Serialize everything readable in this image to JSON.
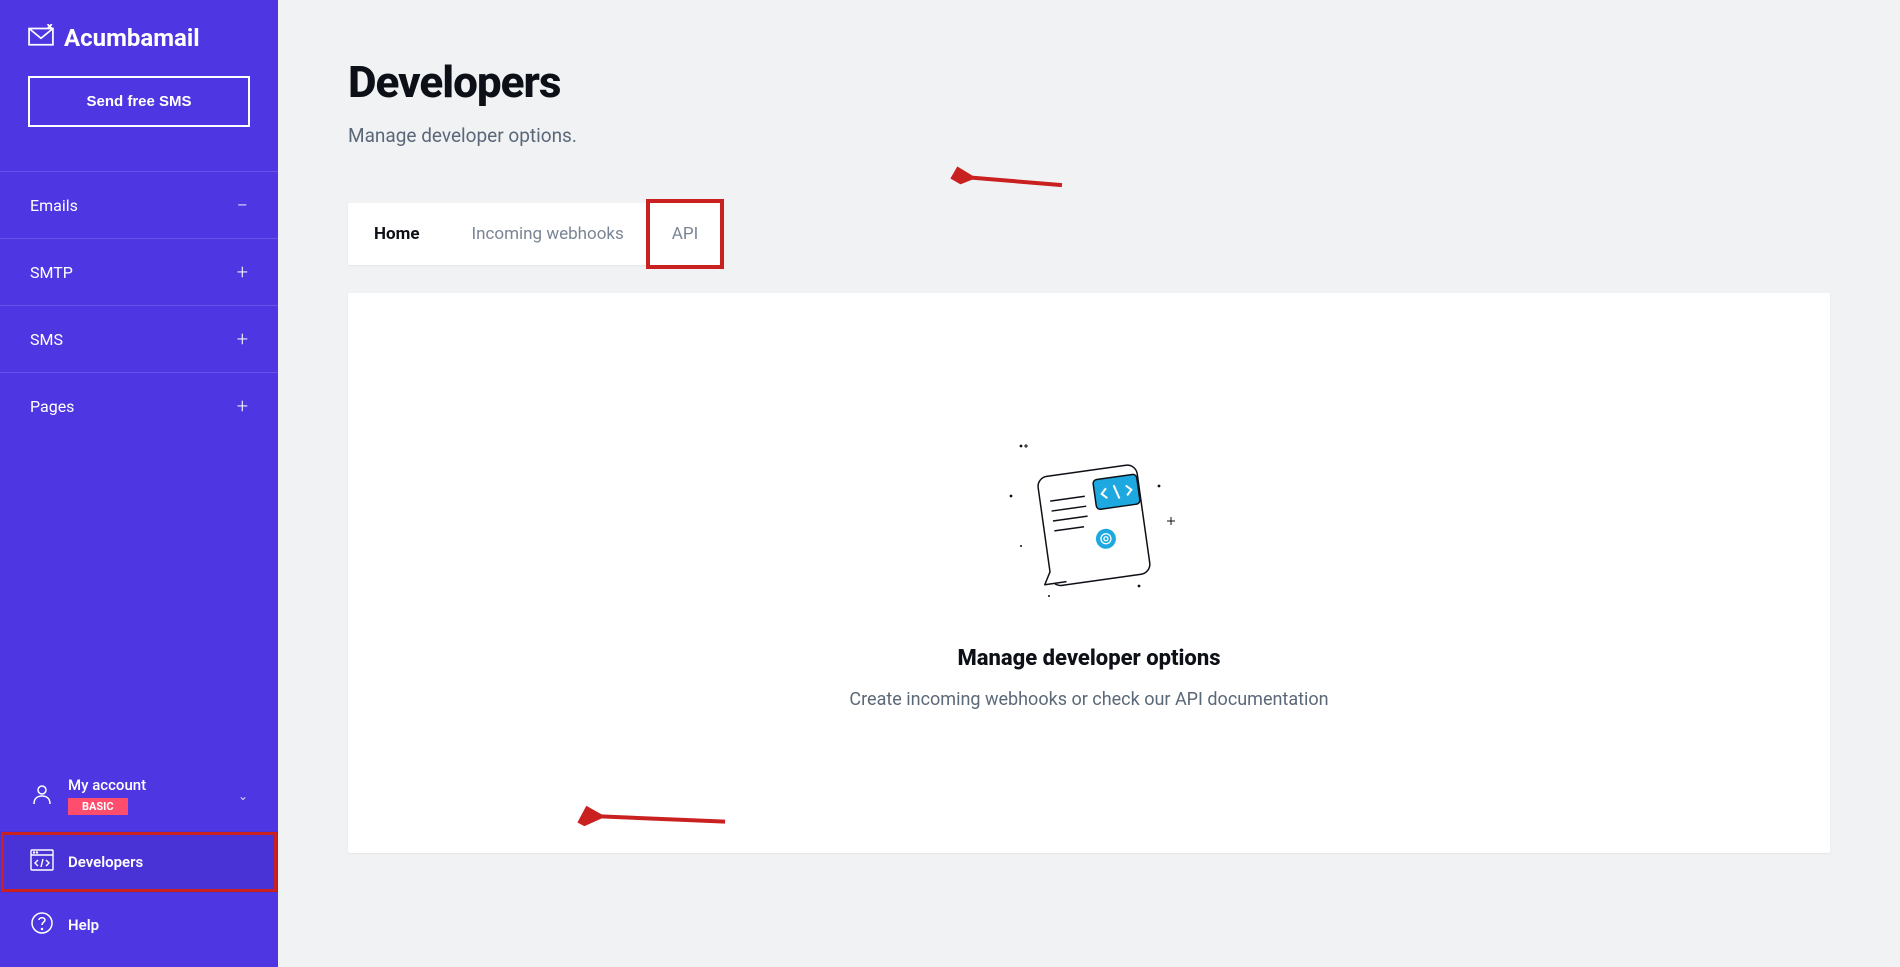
{
  "brand": {
    "name": "Acumbamail"
  },
  "sidebar": {
    "cta_label": "Send free SMS",
    "nav": [
      {
        "label": "Emails",
        "expanded": true
      },
      {
        "label": "SMTP",
        "expanded": false
      },
      {
        "label": "SMS",
        "expanded": false
      },
      {
        "label": "Pages",
        "expanded": false
      }
    ],
    "account": {
      "label": "My account",
      "badge": "BASIC"
    },
    "bottom": [
      {
        "label": "Developers",
        "highlighted": true
      },
      {
        "label": "Help",
        "highlighted": false
      }
    ]
  },
  "page": {
    "title": "Developers",
    "subtitle": "Manage developer options."
  },
  "tabs": [
    {
      "label": "Home",
      "active": true,
      "highlighted": false
    },
    {
      "label": "Incoming webhooks",
      "active": false,
      "highlighted": false
    },
    {
      "label": "API",
      "active": false,
      "highlighted": true
    }
  ],
  "empty_state": {
    "title": "Manage developer options",
    "description": "Create incoming webhooks or check our API documentation"
  },
  "annotations": {
    "highlight_color": "#c92020",
    "arrows": [
      "points to API tab",
      "points to Developers sidebar item"
    ]
  }
}
